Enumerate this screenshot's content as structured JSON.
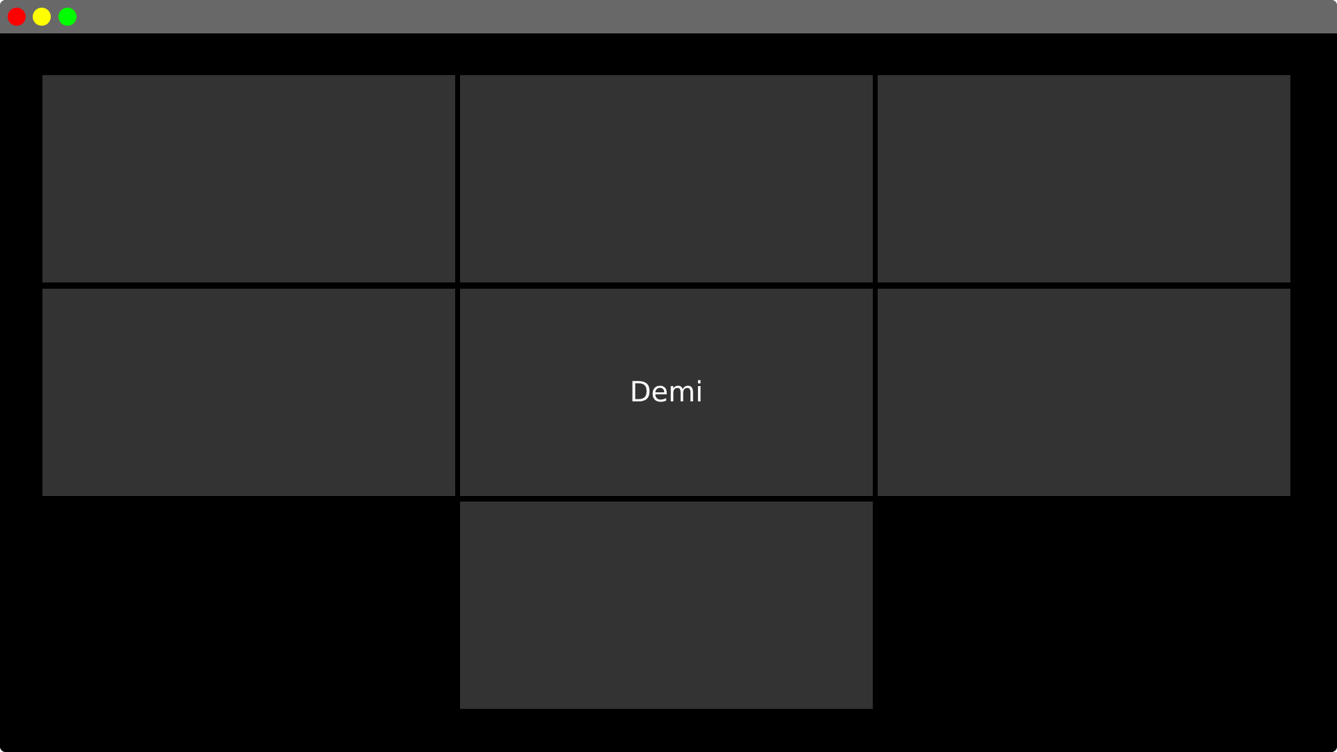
{
  "window": {
    "titlebar_color": "#686868",
    "background_color": "#000000",
    "controls": [
      {
        "name": "close",
        "color": "#ff0000"
      },
      {
        "name": "minimize",
        "color": "#ffff00"
      },
      {
        "name": "maximize",
        "color": "#00ff00"
      }
    ]
  },
  "gallery": {
    "tile_color": "#333333",
    "tiles": [
      {
        "label": ""
      },
      {
        "label": ""
      },
      {
        "label": ""
      },
      {
        "label": ""
      },
      {
        "label": "Demi"
      },
      {
        "label": ""
      },
      {
        "label": ""
      }
    ]
  }
}
